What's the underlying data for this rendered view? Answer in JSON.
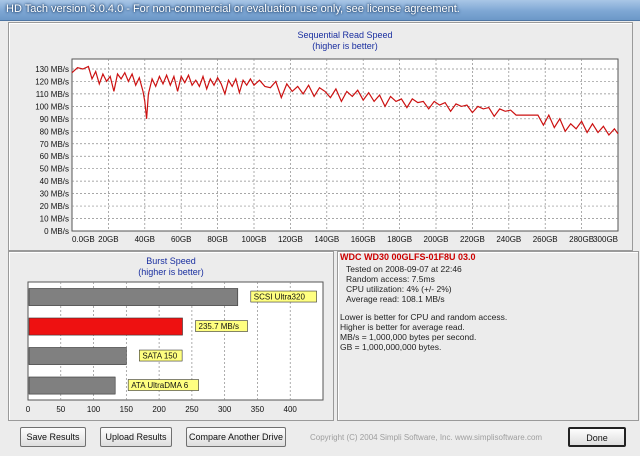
{
  "window": {
    "title": "HD Tach version 3.0.4.0  - For non-commercial or evaluation use only, see license agreement."
  },
  "colors": {
    "read_line": "#cc1111",
    "burst_highlight": "#ee1111",
    "burst_other": "#808080",
    "label_bg": "#ffff80",
    "drive_text": "#cc0000"
  },
  "chart_data": [
    {
      "type": "line",
      "title": "Sequential Read Speed",
      "subtitle": "(higher is better)",
      "x_ticks": [
        "0.0GB",
        "20GB",
        "40GB",
        "60GB",
        "80GB",
        "100GB",
        "120GB",
        "140GB",
        "160GB",
        "180GB",
        "200GB",
        "220GB",
        "240GB",
        "260GB",
        "280GB",
        "300GB"
      ],
      "y_ticks": [
        "0 MB/s",
        "10 MB/s",
        "20 MB/s",
        "30 MB/s",
        "40 MB/s",
        "50 MB/s",
        "60 MB/s",
        "70 MB/s",
        "80 MB/s",
        "90 MB/s",
        "100 MB/s",
        "110 MB/s",
        "120 MB/s",
        "130 MB/s"
      ],
      "xlim": [
        0,
        300
      ],
      "ylim": [
        0,
        138
      ],
      "grid": true,
      "series": [
        {
          "x": [
            0,
            3,
            6,
            9,
            11,
            13,
            15,
            17,
            19,
            21,
            23,
            25,
            27,
            29,
            31,
            33,
            35,
            37,
            39,
            40,
            41,
            42,
            44,
            46,
            48,
            50,
            52,
            54,
            56,
            58,
            60,
            62,
            64,
            66,
            68,
            70,
            72,
            74,
            76,
            78,
            80,
            82,
            84,
            86,
            88,
            90,
            92,
            94,
            96,
            98,
            100,
            103,
            106,
            109,
            112,
            115,
            118,
            121,
            124,
            127,
            130,
            133,
            136,
            139,
            142,
            145,
            148,
            151,
            154,
            157,
            160,
            163,
            166,
            169,
            172,
            175,
            178,
            181,
            184,
            187,
            190,
            193,
            196,
            199,
            202,
            205,
            208,
            211,
            214,
            217,
            220,
            223,
            226,
            229,
            232,
            235,
            238,
            241,
            244,
            247,
            250,
            253,
            256,
            259,
            262,
            265,
            268,
            271,
            274,
            277,
            280,
            283,
            286,
            289,
            292,
            295,
            298,
            300
          ],
          "y": [
            127,
            131,
            130,
            132,
            122,
            128,
            118,
            126,
            120,
            124,
            112,
            126,
            122,
            127,
            120,
            126,
            117,
            123,
            112,
            104,
            90,
            110,
            122,
            116,
            124,
            118,
            125,
            117,
            124,
            112,
            124,
            119,
            125,
            117,
            121,
            116,
            124,
            114,
            122,
            117,
            123,
            118,
            110,
            121,
            116,
            122,
            111,
            121,
            117,
            122,
            117,
            121,
            116,
            115,
            120,
            107,
            118,
            112,
            116,
            110,
            117,
            108,
            115,
            112,
            107,
            114,
            104,
            112,
            108,
            113,
            105,
            111,
            104,
            109,
            100,
            108,
            104,
            106,
            99,
            106,
            103,
            104,
            98,
            104,
            101,
            103,
            96,
            102,
            100,
            101,
            95,
            100,
            98,
            99,
            92,
            98,
            96,
            97,
            93,
            93,
            93,
            93,
            93,
            85,
            93,
            83,
            90,
            80,
            86,
            82,
            88,
            79,
            86,
            79,
            84,
            77,
            82,
            78
          ]
        }
      ]
    },
    {
      "type": "bar",
      "title": "Burst Speed",
      "subtitle": "(higher is better)",
      "categories": [
        "SCSI Ultra320",
        "",
        "SATA 150",
        "ATA UltraDMA 6"
      ],
      "values": [
        320,
        235.7,
        150,
        133
      ],
      "value_labels": [
        "SCSI Ultra320",
        "235.7 MB/s",
        "SATA 150",
        "ATA UltraDMA 6"
      ],
      "highlight_index": 1,
      "x_ticks": [
        "0",
        "50",
        "100",
        "150",
        "200",
        "250",
        "300",
        "350",
        "400"
      ],
      "xlim": [
        0,
        450
      ],
      "grid": true
    }
  ],
  "drive": {
    "name": "WDC WD30 00GLFS-01F8U 03.0",
    "tested_on": "Tested on 2008-09-07 at 22:46",
    "random_access": "Random access: 7.5ms",
    "cpu": "CPU utilization: 4% (+/- 2%)",
    "average": "Average read: 108.1 MB/s",
    "notes": [
      "Lower is better for CPU and random access.",
      "Higher is better for average read.",
      "MB/s = 1,000,000 bytes per second.",
      "GB = 1,000,000,000 bytes."
    ]
  },
  "buttons": {
    "save": "Save Results",
    "upload": "Upload Results",
    "compare": "Compare Another Drive",
    "done": "Done"
  },
  "copyright": "Copyright (C) 2004 Simpli Software, Inc. www.simplisoftware.com"
}
